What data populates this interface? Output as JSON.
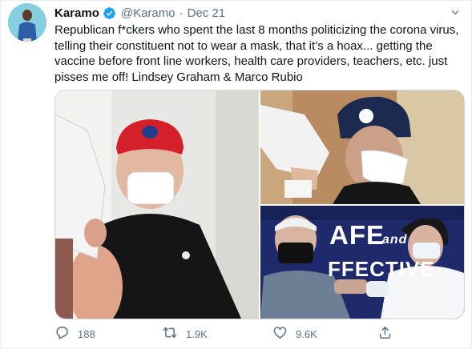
{
  "tweet": {
    "display_name": "Karamo",
    "handle": "@Karamo",
    "separator": "·",
    "date": "Dec 21",
    "body": "Republican f*ckers who spent the last 8 months politicizing the corona virus, telling their constituent not to wear a mask, that it’s a hoax... getting the vaccine before front line workers, health care providers, teachers, etc. just pisses me off! Lindsey Graham & Marco Rubio",
    "photo_sign_text": {
      "line1": "AFE",
      "and": "and",
      "line2": "FFECTIVE"
    }
  },
  "actions": {
    "reply_count": "188",
    "retweet_count": "1.9K",
    "like_count": "9.6K"
  },
  "icons": {
    "reply": "reply-icon",
    "retweet": "retweet-icon",
    "like": "heart-icon",
    "share": "share-icon",
    "verified": "verified-badge-icon",
    "more": "chevron-down-icon"
  },
  "colors": {
    "verified_blue": "#1da1f2",
    "action_gray": "#5b7083",
    "text": "#0f1419"
  }
}
